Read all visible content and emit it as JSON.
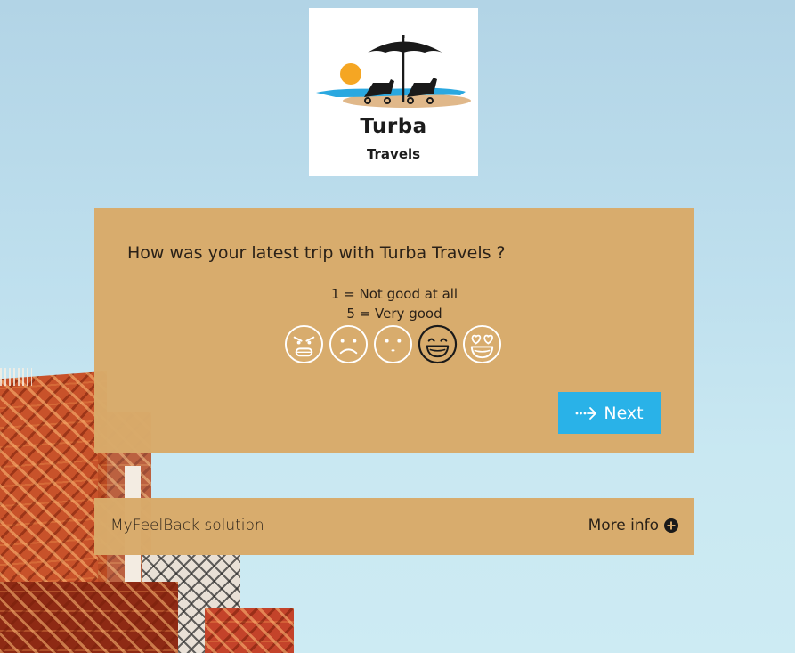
{
  "brand": {
    "title": "Turba",
    "subtitle": "Travels",
    "colors": {
      "sun": "#f5a623",
      "water": "#2aa8e0",
      "sand": "#e0b88a",
      "dark": "#1a1a1a"
    }
  },
  "survey": {
    "question": "How was your latest trip with Turba Travels ?",
    "scale_low": "1 = Not good at all",
    "scale_high": "5 = Very good",
    "rating_options": [
      {
        "value": 1,
        "icon": "angry-face-icon"
      },
      {
        "value": 2,
        "icon": "sad-face-icon"
      },
      {
        "value": 3,
        "icon": "neutral-face-icon"
      },
      {
        "value": 4,
        "icon": "grinning-face-icon",
        "highlighted": true
      },
      {
        "value": 5,
        "icon": "heart-eyes-face-icon"
      }
    ],
    "next_label": "Next",
    "next_icon": "dotted-arrow-right-icon"
  },
  "footer": {
    "solution_label": "MyFeelBack solution",
    "more_info_label": "More info",
    "more_info_icon": "plus-circle-icon"
  },
  "theme": {
    "card_color": "#d8aa6a",
    "button_color": "#29b2e8",
    "background_color": "#b2d4e6"
  }
}
